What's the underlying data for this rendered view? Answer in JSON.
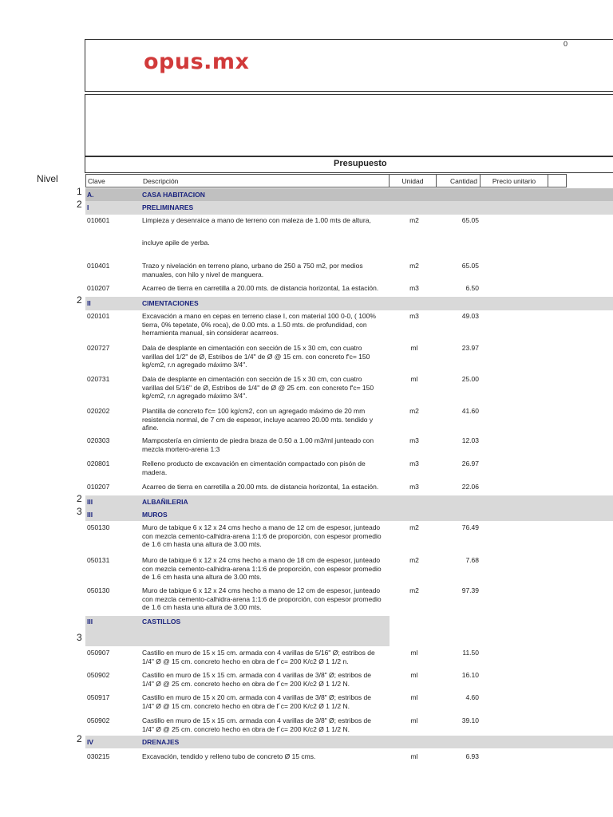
{
  "header": {
    "logo": "opus.mx",
    "page_number": "0",
    "title": "Presupuesto",
    "level_label": "Nivel"
  },
  "columns": {
    "clave": "Clave",
    "descripcion": "Descripción",
    "unidad": "Unidad",
    "cantidad": "Cantidad",
    "precio": "Precio unitario"
  },
  "rows": [
    {
      "type": "section",
      "level": "1",
      "clave": "A.",
      "desc": "CASA HABITACION"
    },
    {
      "type": "section",
      "level": "2",
      "clave": "I",
      "desc": "PRELIMINARES"
    },
    {
      "type": "item",
      "clave": "010601",
      "desc": "Limpieza y desenraice a mano de terreno con maleza de 1.00 mts de altura,",
      "unit": "m2",
      "qty": "65.05"
    },
    {
      "type": "text",
      "desc": "incluye apile de yerba."
    },
    {
      "type": "item",
      "clave": "010401",
      "desc": "Trazo y nivelación en terreno plano, urbano de 250 a 750 m2, por medios manuales, con hilo y nivel de manguera.",
      "unit": "m2",
      "qty": "65.05"
    },
    {
      "type": "item",
      "clave": "010207",
      "desc": "Acarreo de tierra en carretilla a 20.00 mts. de distancia horizontal, 1a estación.",
      "unit": "m3",
      "qty": "6.50"
    },
    {
      "type": "section",
      "level": "2",
      "clave": "II",
      "desc": "CIMENTACIONES"
    },
    {
      "type": "item",
      "clave": "020101",
      "desc": "Excavación a mano en cepas en terreno clase I, con material 100 0-0, ( 100% tierra, 0% tepetate, 0% roca), de 0.00 mts. a 1.50 mts. de profundidad, con herramienta manual, sin considerar acarreos.",
      "unit": "m3",
      "qty": "49.03"
    },
    {
      "type": "item",
      "clave": "020727",
      "desc": "Dala de desplante en cimentación con sección de 15 x 30 cm, con cuatro varillas del 1/2\" de Ø, Estribos de 1/4\" de Ø @ 15 cm. con concreto f'c= 150 kg/cm2, r.n agregado máximo 3/4\".",
      "unit": "ml",
      "qty": "23.97"
    },
    {
      "type": "item",
      "clave": "020731",
      "desc": "Dala de desplante en cimentación con sección de 15 x 30 cm, con cuatro varillas del 5/16\" de Ø, Estribos de 1/4\" de Ø @ 25 cm. con concreto f'c= 150 kg/cm2, r.n agregado máximo 3/4\".",
      "unit": "ml",
      "qty": "25.00"
    },
    {
      "type": "item",
      "clave": "020202",
      "desc": "Plantilla de concreto f'c= 100 kg/cm2, con un agregado máximo de 20 mm resistencia normal, de 7 cm de espesor, incluye acarreo 20.00 mts. tendido y afine.",
      "unit": "m2",
      "qty": "41.60"
    },
    {
      "type": "item",
      "clave": "020303",
      "desc": "Mampostería en cimiento de piedra braza de 0.50 a 1.00 m3/ml junteado con mezcla mortero-arena 1:3",
      "unit": "m3",
      "qty": "12.03"
    },
    {
      "type": "item",
      "clave": "020801",
      "desc": "Relleno producto de excavación en cimentación compactado con pisón de madera.",
      "unit": "m3",
      "qty": "26.97"
    },
    {
      "type": "item",
      "clave": "010207",
      "desc": "Acarreo de tierra en carretilla a 20.00 mts. de distancia horizontal, 1a estación.",
      "unit": "m3",
      "qty": "22.06"
    },
    {
      "type": "section",
      "level": "2",
      "clave": "III",
      "desc": "ALBAÑILERIA"
    },
    {
      "type": "section",
      "level": "3",
      "clave": "III",
      "desc": "MUROS"
    },
    {
      "type": "item",
      "clave": "050130",
      "desc": "Muro de tabique 6 x 12 x 24 cms hecho a mano de 12 cm de espesor, junteado con mezcla cemento-calhidra-arena 1:1:6 de proporción, con espesor promedio de 1.6 cm hasta una altura de 3.00 mts.",
      "unit": "m2",
      "qty": "76.49"
    },
    {
      "type": "item",
      "clave": "050131",
      "desc": "Muro de tabique 6 x 12 x 24 cms hecho a mano de 18 cm de espesor, junteado  con mezcla cemento-calhidra-arena 1:1:6 de proporción, con espesor promedio de 1.6 cm hasta una altura de 3.00 mts.",
      "unit": "m2",
      "qty": "7.68"
    },
    {
      "type": "item",
      "clave": "050130",
      "desc": "Muro de tabique 6 x 12 x 24 cms hecho a mano de 12 cm de espesor, junteado con mezcla cemento-calhidra-arena 1:1:6 de proporción, con espesor promedio de 1.6 cm hasta una altura de 3.00 mts.",
      "unit": "m2",
      "qty": "97.39"
    },
    {
      "type": "section",
      "level": "3",
      "clave": "III",
      "desc": "CASTILLOS"
    },
    {
      "type": "item",
      "clave": "050907",
      "desc": "Castillo en muro de 15 x 15 cm. armada con 4 varillas de 5/16\" Ø; estribos de 1/4\" Ø @ 15 cm. concreto hecho en obra de f´c= 200 K/c2 Ø 1 1/2 n.",
      "unit": "ml",
      "qty": "11.50"
    },
    {
      "type": "item",
      "clave": "050902",
      "desc": "Castillo en muro de 15 x 15 cm. armada con 4 varillas de 3/8\" Ø; estribos de 1/4\" Ø @ 25 cm. concreto hecho en obra de f´c= 200 K/c2 Ø 1 1/2 N.",
      "unit": "ml",
      "qty": "16.10"
    },
    {
      "type": "item",
      "clave": "050917",
      "desc": "Castillo en muro de 15 x 20 cm. armada con 4 varillas de 3/8\" Ø; estribos de 1/4\" Ø @ 15 cm. concreto hecho en obra de f´c= 200 K/c2 Ø 1 1/2 N.",
      "unit": "ml",
      "qty": "4.60"
    },
    {
      "type": "item",
      "clave": "050902",
      "desc": "Castillo en muro de 15 x 15 cm. armada con 4 varillas de 3/8\" Ø; estribos de 1/4\" Ø @ 25 cm. concreto hecho en obra de f´c= 200 K/c2 Ø 1 1/2 N.",
      "unit": "ml",
      "qty": "39.10"
    },
    {
      "type": "section",
      "level": "2",
      "clave": "IV",
      "desc": "DRENAJES"
    },
    {
      "type": "item",
      "clave": "030215",
      "desc": "Excavación, tendido y relleno tubo de concreto Ø 15 cms.",
      "unit": "ml",
      "qty": "6.93"
    }
  ]
}
